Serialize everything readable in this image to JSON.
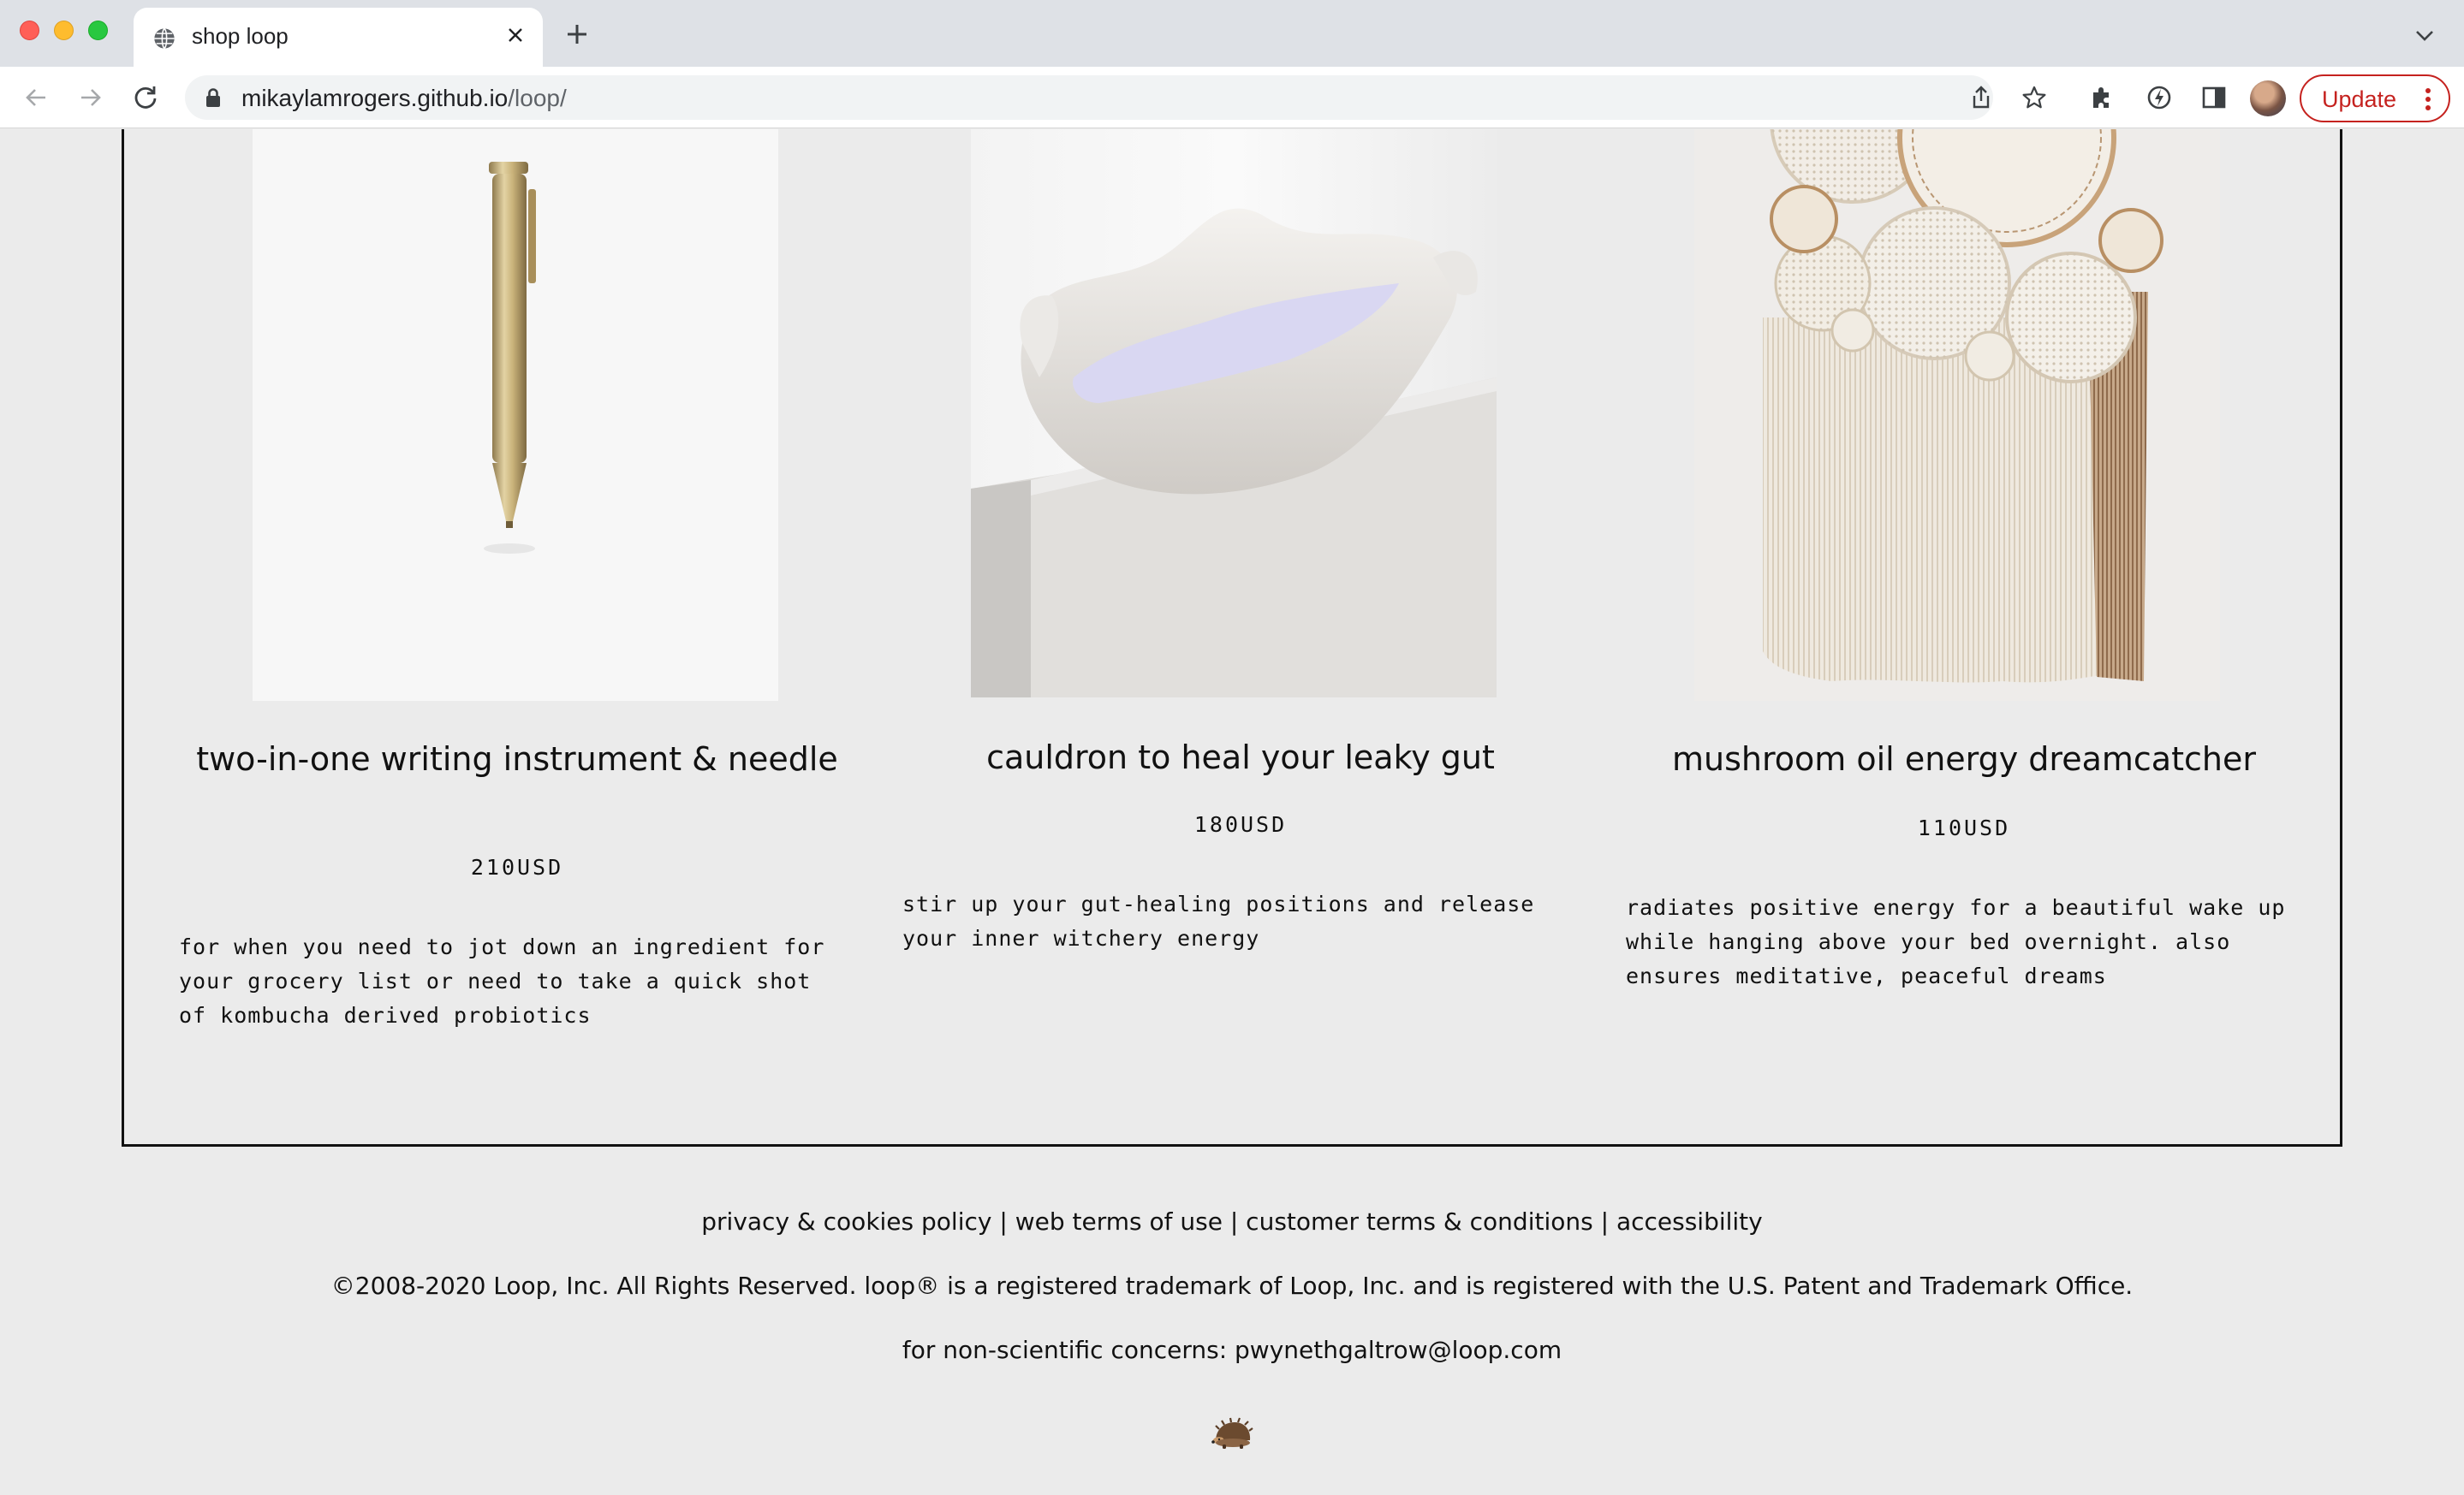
{
  "browser": {
    "tab_title": "shop loop",
    "url_host": "mikaylamrogers.github.io",
    "url_path": "/loop/",
    "update_label": "Update"
  },
  "products": [
    {
      "title": "two-in-one writing instrument & needle",
      "price": "210USD",
      "description": "for when you need to jot down an ingredient for your grocery list or need to take a quick shot of kombucha derived probiotics",
      "image": "brass-pen-image"
    },
    {
      "title": "cauldron to heal your leaky gut",
      "price": "180USD",
      "description": "stir up your gut-healing positions and release your inner witchery energy",
      "image": "ceramic-bowl-image"
    },
    {
      "title": "mushroom oil energy dreamcatcher",
      "price": "110USD",
      "description": "radiates positive energy for a beautiful wake up while hanging above your bed overnight. also ensures meditative, peaceful dreams",
      "image": "dreamcatcher-image"
    }
  ],
  "footer": {
    "links": [
      "privacy & cookies policy",
      "web terms of use",
      "customer terms & conditions",
      "accessibility"
    ],
    "separator": " | ",
    "copyright": "©2008-2020 Loop, Inc. All Rights Reserved. loop® is a registered trademark of Loop, Inc. and is registered with the U.S. Patent and Trademark Office.",
    "contact": "for non-scientific concerns: pwynethgaltrow@loop.com",
    "mascot": "hedgehog-icon"
  },
  "colors": {
    "page_bg": "#ebebeb",
    "update_red": "#c5221f",
    "text": "#111111"
  }
}
